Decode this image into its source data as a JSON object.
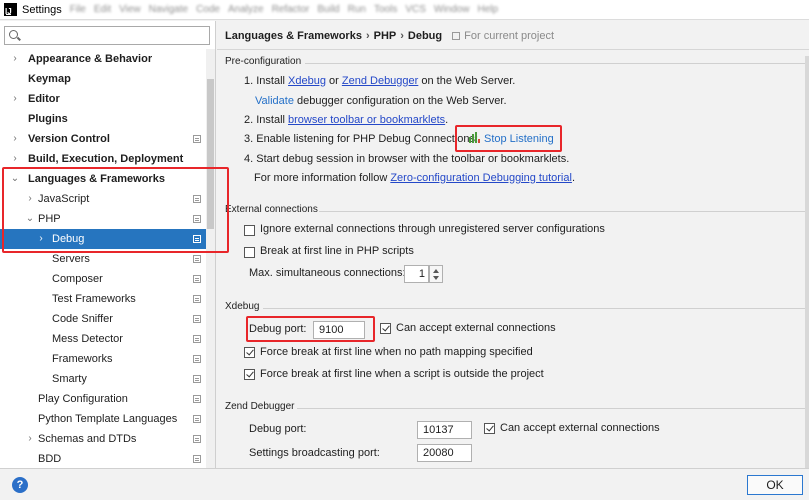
{
  "window": {
    "title": "Settings",
    "menu_blurred": [
      "File",
      "Edit",
      "View",
      "Navigate",
      "Code",
      "Analyze",
      "Refactor",
      "Build",
      "Run",
      "Tools",
      "VCS",
      "Window",
      "Help"
    ]
  },
  "search": {
    "placeholder": "",
    "value": ""
  },
  "sidebar": {
    "items": [
      {
        "label": "Appearance & Behavior",
        "arrow": "›",
        "bold": true,
        "level": 0,
        "project": false
      },
      {
        "label": "Keymap",
        "arrow": "",
        "bold": true,
        "level": 0,
        "project": false
      },
      {
        "label": "Editor",
        "arrow": "›",
        "bold": true,
        "level": 0,
        "project": false
      },
      {
        "label": "Plugins",
        "arrow": "",
        "bold": true,
        "level": 0,
        "project": false
      },
      {
        "label": "Version Control",
        "arrow": "›",
        "bold": true,
        "level": 0,
        "project": true
      },
      {
        "label": "Build, Execution, Deployment",
        "arrow": "›",
        "bold": true,
        "level": 0,
        "project": false
      },
      {
        "label": "Languages & Frameworks",
        "arrow": "⌄",
        "bold": true,
        "level": 0,
        "project": false
      },
      {
        "label": "JavaScript",
        "arrow": "›",
        "bold": false,
        "level": 1,
        "project": true
      },
      {
        "label": "PHP",
        "arrow": "⌄",
        "bold": false,
        "level": 1,
        "project": true
      },
      {
        "label": "Debug",
        "arrow": "›",
        "bold": false,
        "level": 2,
        "project": true,
        "selected": true
      },
      {
        "label": "Servers",
        "arrow": "",
        "bold": false,
        "level": 2,
        "project": true
      },
      {
        "label": "Composer",
        "arrow": "",
        "bold": false,
        "level": 2,
        "project": true
      },
      {
        "label": "Test Frameworks",
        "arrow": "",
        "bold": false,
        "level": 2,
        "project": true
      },
      {
        "label": "Code Sniffer",
        "arrow": "",
        "bold": false,
        "level": 2,
        "project": true
      },
      {
        "label": "Mess Detector",
        "arrow": "",
        "bold": false,
        "level": 2,
        "project": true
      },
      {
        "label": "Frameworks",
        "arrow": "",
        "bold": false,
        "level": 2,
        "project": true
      },
      {
        "label": "Smarty",
        "arrow": "",
        "bold": false,
        "level": 2,
        "project": true
      },
      {
        "label": "Play Configuration",
        "arrow": "",
        "bold": false,
        "level": 1,
        "project": true
      },
      {
        "label": "Python Template Languages",
        "arrow": "",
        "bold": false,
        "level": 1,
        "project": true
      },
      {
        "label": "Schemas and DTDs",
        "arrow": "›",
        "bold": false,
        "level": 1,
        "project": true
      },
      {
        "label": "BDD",
        "arrow": "",
        "bold": false,
        "level": 1,
        "project": true
      }
    ]
  },
  "breadcrumb": {
    "parts": [
      "Languages & Frameworks",
      "PHP",
      "Debug"
    ],
    "separator": "›",
    "scope": "For current project"
  },
  "preconfig": {
    "title": "Pre-configuration",
    "step1_prefix": "1. Install ",
    "xdebug_link": "Xdebug",
    "or_text": " or ",
    "zend_link": "Zend Debugger",
    "step1_suffix": " on the Web Server.",
    "validate_link": "Validate",
    "validate_suffix": " debugger configuration on the Web Server.",
    "step2_prefix": "2. Install ",
    "bookmarklets_link": "browser toolbar or bookmarklets",
    "step2_suffix": ".",
    "step3": "3. Enable listening for PHP Debug Connections:",
    "stop_listening": "Stop Listening",
    "step4": "4. Start debug session in browser with the toolbar or bookmarklets.",
    "moreinfo_prefix": "For more information follow ",
    "tutorial_link": "Zero-configuration Debugging tutorial",
    "moreinfo_suffix": "."
  },
  "external": {
    "title": "External connections",
    "ignore_label": "Ignore external connections through unregistered server configurations",
    "ignore_checked": false,
    "break_label": "Break at first line in PHP scripts",
    "break_checked": false,
    "max_label": "Max. simultaneous connections:",
    "max_value": "1"
  },
  "xdebug": {
    "title": "Xdebug",
    "port_label": "Debug port:",
    "port_value": "9100",
    "accept_label": "Can accept external connections",
    "accept_checked": true,
    "force_nomap_label": "Force break at first line when no path mapping specified",
    "force_nomap_checked": true,
    "force_outside_label": "Force break at first line when a script is outside the project",
    "force_outside_checked": true
  },
  "zend": {
    "title": "Zend Debugger",
    "port_label": "Debug port:",
    "port_value": "10137",
    "accept_label": "Can accept external connections",
    "accept_checked": true,
    "broadcast_label": "Settings broadcasting port:",
    "broadcast_value": "20080"
  },
  "footer": {
    "help_glyph": "?",
    "ok_label": "OK"
  },
  "colors": {
    "selection": "#2675bf",
    "link": "#2448c8",
    "highlight": "#e8262a",
    "accent": "#2b78d0"
  }
}
